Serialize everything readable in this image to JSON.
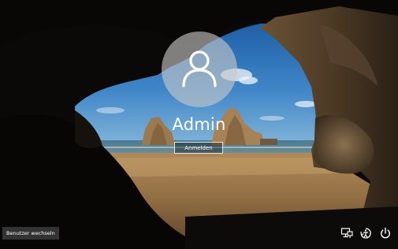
{
  "login": {
    "username": "Admin",
    "sign_in_label": "Anmelden"
  },
  "footer": {
    "switch_user_label": "Benutzer wechseln"
  },
  "icons": {
    "avatar": "user-icon",
    "network": "network-icon",
    "accessibility": "ease-of-access-icon",
    "power": "power-icon"
  },
  "colors": {
    "avatar_bg": "#c8c8c8",
    "text": "#ffffff",
    "switch_user_bg": "#3c3c3c"
  }
}
